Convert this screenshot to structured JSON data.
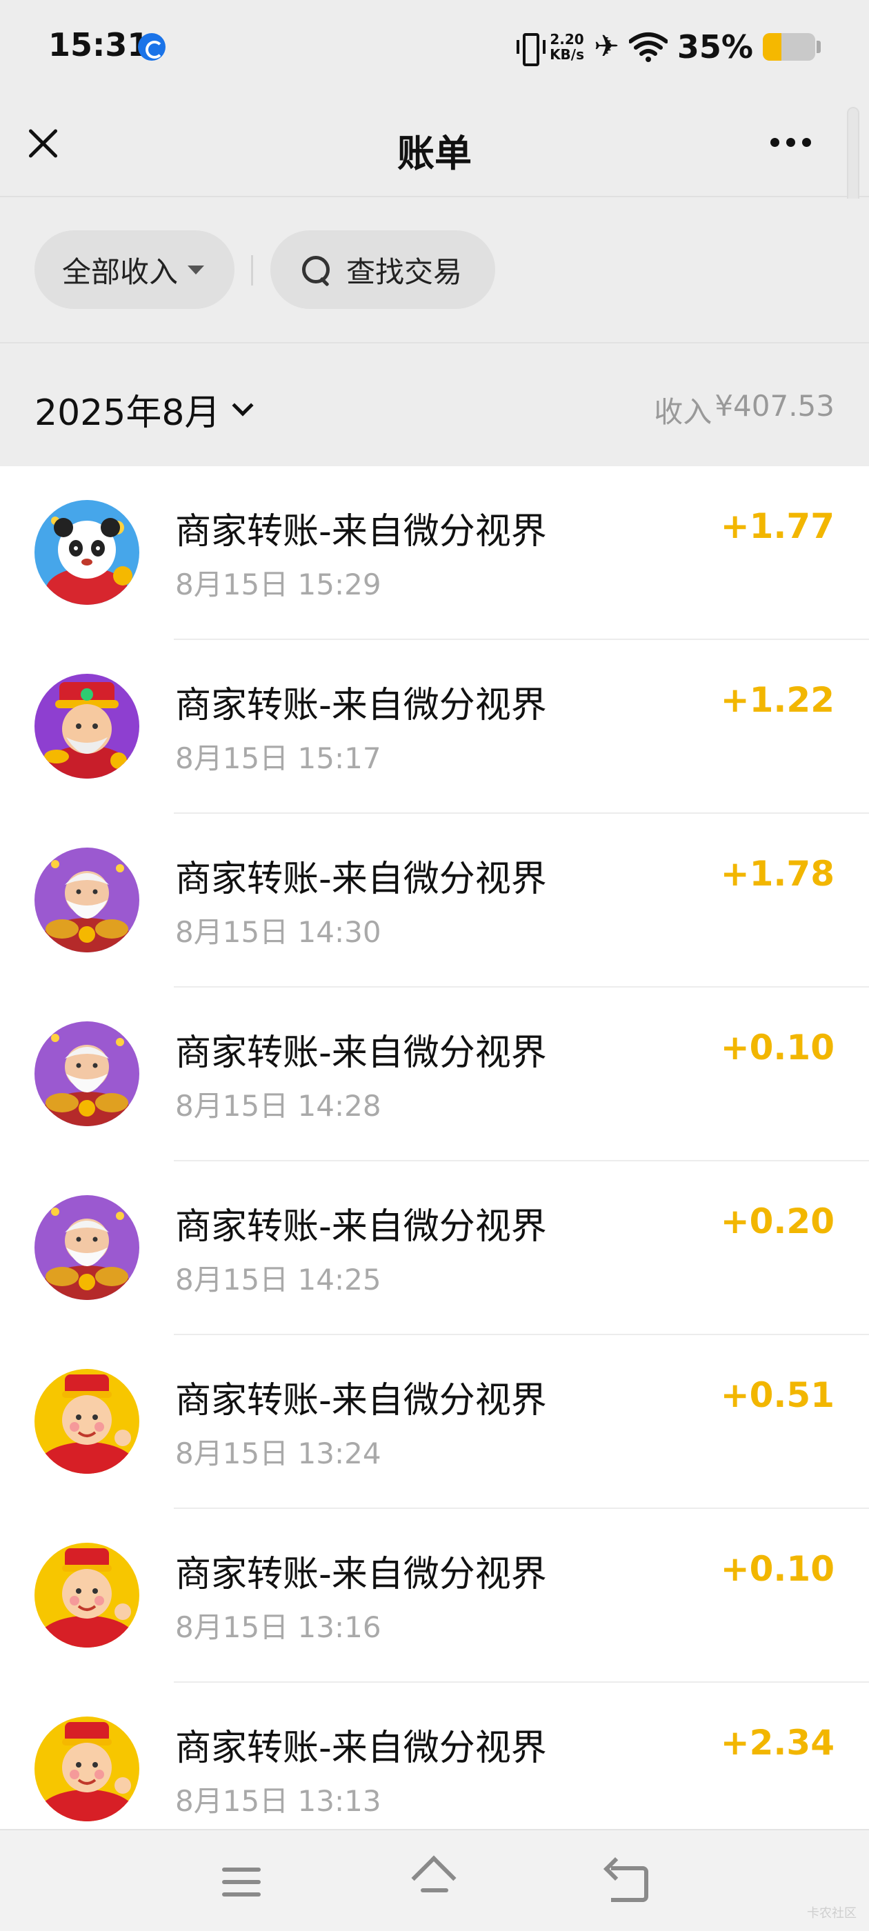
{
  "status_bar": {
    "time": "15:31",
    "net_speed_value": "2.20",
    "net_speed_unit": "KB/s",
    "battery_text": "35%",
    "battery_level": 0.35,
    "battery_color": "#f5b800",
    "icons": [
      "notification-app-icon",
      "vibrate-icon",
      "airplane-icon",
      "wifi-icon",
      "battery-icon"
    ]
  },
  "header": {
    "title": "账单",
    "close_icon": "close-icon",
    "more_icon": "more-dots-icon"
  },
  "filters": {
    "income_filter_label": "全部收入",
    "search_label": "查找交易"
  },
  "month": {
    "label": "2025年8月",
    "total_prefix": "收入",
    "total_amount": "¥407.53"
  },
  "transactions": [
    {
      "title": "商家转账-来自微分视界",
      "time": "8月15日 15:29",
      "amount": "+1.77",
      "avatar": "panda-avatar-icon"
    },
    {
      "title": "商家转账-来自微分视界",
      "time": "8月15日 15:17",
      "amount": "+1.22",
      "avatar": "fortune-god-avatar-icon"
    },
    {
      "title": "商家转账-来自微分视界",
      "time": "8月15日 14:30",
      "amount": "+1.78",
      "avatar": "elder-fortune-avatar-icon"
    },
    {
      "title": "商家转账-来自微分视界",
      "time": "8月15日 14:28",
      "amount": "+0.10",
      "avatar": "elder-fortune-avatar-icon"
    },
    {
      "title": "商家转账-来自微分视界",
      "time": "8月15日 14:25",
      "amount": "+0.20",
      "avatar": "elder-fortune-avatar-icon"
    },
    {
      "title": "商家转账-来自微分视界",
      "time": "8月15日 13:24",
      "amount": "+0.51",
      "avatar": "wealth-boy-avatar-icon"
    },
    {
      "title": "商家转账-来自微分视界",
      "time": "8月15日 13:16",
      "amount": "+0.10",
      "avatar": "wealth-boy-avatar-icon"
    },
    {
      "title": "商家转账-来自微分视界",
      "time": "8月15日 13:13",
      "amount": "+2.34",
      "avatar": "wealth-boy-avatar-icon"
    }
  ],
  "colors": {
    "amount": "#f2b600",
    "background": "#ededed",
    "list_background": "#ffffff"
  },
  "system_nav": {
    "icons": [
      "menu-icon",
      "home-icon",
      "back-icon"
    ]
  },
  "watermark": "卡农社区"
}
